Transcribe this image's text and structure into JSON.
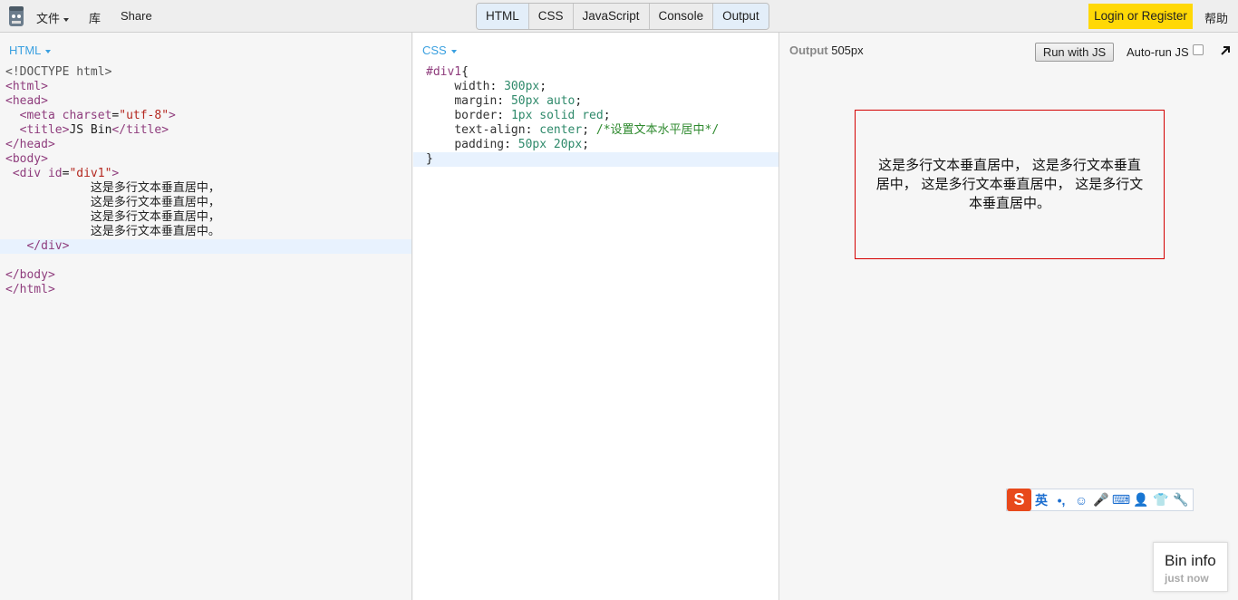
{
  "topbar": {
    "file_menu": "文件",
    "library_menu": "库",
    "share_menu": "Share",
    "tabs": [
      {
        "label": "HTML",
        "active": true
      },
      {
        "label": "CSS",
        "active": false
      },
      {
        "label": "JavaScript",
        "active": false
      },
      {
        "label": "Console",
        "active": false
      },
      {
        "label": "Output",
        "active": true
      }
    ],
    "login_label": "Login or Register",
    "help_label": "帮助",
    "login_color": "#ffd806"
  },
  "html_panel": {
    "label": "HTML"
  },
  "css_panel": {
    "label": "CSS"
  },
  "output_panel": {
    "label": "Output",
    "width_label": "505px",
    "run_button": "Run with JS",
    "autorun_label": "Auto-run JS",
    "autorun_checked": false,
    "demo_text": "这是多行文本垂直居中， 这是多行文本垂直居中， 这是多行文本垂直居中， 这是多行文本垂直居中。"
  },
  "html_code": [
    "<!DOCTYPE html>",
    "<html>",
    "<head>",
    "  <meta charset=\"utf-8\">",
    "  <title>JS Bin</title>",
    "</head>",
    "<body>",
    " <div id=\"div1\">",
    "            这是多行文本垂直居中，",
    "            这是多行文本垂直居中，",
    "            这是多行文本垂直居中，",
    "            这是多行文本垂直居中。",
    "   </div>",
    "",
    "</body>",
    "</html>"
  ],
  "css_code": [
    "#div1{",
    "    width: 300px;",
    "    margin: 50px auto;",
    "    border: 1px solid red;",
    "    text-align: center; /*设置文本水平居中*/",
    "    padding: 50px 20px;",
    "}"
  ],
  "ime_toolbar": {
    "logo": "S",
    "items": [
      "英",
      "•,",
      "☺",
      "🎤",
      "⌨",
      "👤",
      "👕",
      "🔧"
    ]
  },
  "bin_info": {
    "title": "Bin info",
    "subtitle": "just now"
  }
}
